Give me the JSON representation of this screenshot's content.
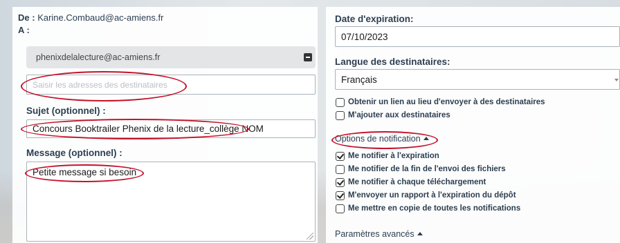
{
  "left": {
    "from_label": "De :",
    "from_value": "Karine.Combaud@ac-amiens.fr",
    "to_label": "A :",
    "recipient_chip": "phenixdelalecture@ac-amiens.fr",
    "recipients_placeholder": "Saisir les adresses des destinataires",
    "subject_label": "Sujet (optionnel) :",
    "subject_value": "Concours Booktrailer Phenix de la lecture_collège NOM",
    "message_label": "Message (optionnel) :",
    "message_value": "Petite message si besoin"
  },
  "right": {
    "expiration_label": "Date d'expiration:",
    "expiration_value": "07/10/2023",
    "language_label": "Langue des destinataires:",
    "language_value": "Français",
    "checkboxes": [
      {
        "label": "Obtenir un lien au lieu d'envoyer à des destinataires",
        "checked": false
      },
      {
        "label": "M'ajouter aux destinataires",
        "checked": false
      }
    ],
    "notification_options_label": "Options de notification",
    "notifications": [
      {
        "label": "Me notifier à l'expiration",
        "checked": true
      },
      {
        "label": "Me notifier de la fin de l'envoi des fichiers",
        "checked": false
      },
      {
        "label": "Me notifier à chaque téléchargement",
        "checked": true
      },
      {
        "label": "M'envoyer un rapport à l'expiration du dépôt",
        "checked": true
      },
      {
        "label": "Me mettre en copie de toutes les notifications",
        "checked": false
      }
    ],
    "advanced_label": "Paramètres avancés"
  },
  "colors": {
    "annotation": "#c4122a",
    "text": "#2c3e50"
  }
}
